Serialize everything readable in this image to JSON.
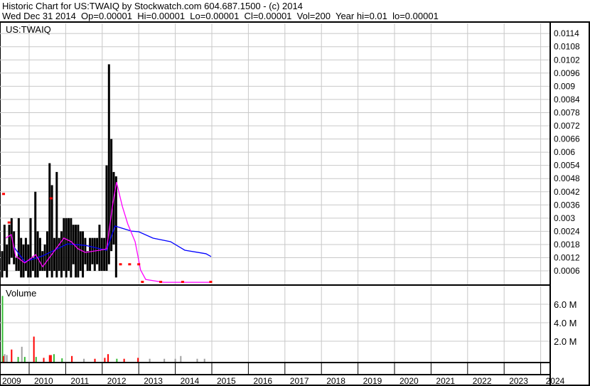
{
  "header": {
    "line1": "Historic Chart for US:TWAIQ by Stockwatch.com 604.687.1500 - (c) 2014",
    "line2": "Wed Dec 31 2014  Op=0.00001  Hi=0.00001  Lo=0.00001  Cl=0.00001  Vol=200  Year hi=0.01  lo=0.00001"
  },
  "colors": {
    "bars": "#000000",
    "ma_short": "#ff00ff",
    "ma_long": "#0000ff",
    "marker": "#ff0000",
    "grid": "#c8c8c8",
    "vol_up": "#33bb33",
    "vol_down": "#ff0000",
    "vol_flat": "#a0a0a0"
  },
  "chart_data": [
    {
      "type": "line",
      "title": "US:TWAIQ",
      "ylim": [
        0,
        0.0117
      ],
      "y_ticks": [
        "0.0114",
        "0.0108",
        "0.0102",
        "0.0096",
        "0.009",
        "0.0084",
        "0.0078",
        "0.0072",
        "0.0066",
        "0.006",
        "0.0054",
        "0.0048",
        "0.0042",
        "0.0036",
        "0.003",
        "0.0024",
        "0.0018",
        "0.0012",
        "0.0006"
      ],
      "y_tick_values": [
        0.0114,
        0.0108,
        0.0102,
        0.0096,
        0.009,
        0.0084,
        0.0078,
        0.0072,
        0.0066,
        0.006,
        0.0054,
        0.0048,
        0.0042,
        0.0036,
        0.003,
        0.0024,
        0.0018,
        0.0012,
        0.0006
      ],
      "x_range_years": [
        2009.2,
        2024.3
      ],
      "bars_start_year": 2009.26,
      "bars_step_years": 0.065,
      "bars_low_high": [
        [
          0.0003,
          0.0015
        ],
        [
          0.0006,
          0.0027
        ],
        [
          0.0003,
          0.0018
        ],
        [
          0.0009,
          0.0027
        ],
        [
          0.0012,
          0.003
        ],
        [
          0.0009,
          0.0024
        ],
        [
          0.0006,
          0.0012
        ],
        [
          0.0006,
          0.003
        ],
        [
          0.0003,
          0.0021
        ],
        [
          0.0003,
          0.0018
        ],
        [
          0.0006,
          0.0021
        ],
        [
          0.0003,
          0.0018
        ],
        [
          0.0003,
          0.003
        ],
        [
          0.0006,
          0.0012
        ],
        [
          0.0003,
          0.0042
        ],
        [
          0.0003,
          0.0024
        ],
        [
          0.0006,
          0.0021
        ],
        [
          0.0006,
          0.0015
        ],
        [
          0.0006,
          0.0018
        ],
        [
          0.0003,
          0.0024
        ],
        [
          0.0006,
          0.0055
        ],
        [
          0.0003,
          0.0045
        ],
        [
          0.0006,
          0.0021
        ],
        [
          0.0003,
          0.0051
        ],
        [
          0.0006,
          0.0021
        ],
        [
          0.0003,
          0.0024
        ],
        [
          0.0006,
          0.003
        ],
        [
          0.0003,
          0.003
        ],
        [
          0.0006,
          0.003
        ],
        [
          0.0003,
          0.003
        ],
        [
          0.0009,
          0.0027
        ],
        [
          0.0003,
          0.0027
        ],
        [
          0.0003,
          0.0027
        ],
        [
          0.0006,
          0.0024
        ],
        [
          0.0003,
          0.0024
        ],
        [
          0.0009,
          0.0021
        ],
        [
          0.0006,
          0.0015
        ],
        [
          0.0006,
          0.0021
        ],
        [
          0.0009,
          0.0021
        ],
        [
          0.0006,
          0.0021
        ],
        [
          0.0009,
          0.0021
        ],
        [
          0.0006,
          0.0027
        ],
        [
          0.0006,
          0.0021
        ],
        [
          0.0006,
          0.0021
        ],
        [
          0.0006,
          0.0054
        ],
        [
          0.0009,
          0.01
        ],
        [
          0.0015,
          0.0066
        ],
        [
          0.0018,
          0.0051
        ],
        [
          0.0003,
          0.0049
        ]
      ],
      "series": [
        {
          "name": "long moving average",
          "color_key": "ma_long",
          "points": [
            [
              2009.59,
              0.00167
            ],
            [
              2009.88,
              0.00102
            ],
            [
              2010.37,
              0.00128
            ],
            [
              2011.05,
              0.00183
            ],
            [
              2011.54,
              0.00176
            ],
            [
              2012.12,
              0.00154
            ],
            [
              2012.35,
              0.00264
            ],
            [
              2012.8,
              0.00241
            ],
            [
              2013.0,
              0.00238
            ],
            [
              2013.39,
              0.00209
            ],
            [
              2013.87,
              0.00193
            ],
            [
              2014.26,
              0.00154
            ],
            [
              2014.84,
              0.00138
            ],
            [
              2014.98,
              0.00125
            ]
          ]
        },
        {
          "name": "short moving average",
          "color_key": "ma_short",
          "points": [
            [
              2009.36,
              0.00209
            ],
            [
              2009.51,
              0.00225
            ],
            [
              2009.63,
              0.00128
            ],
            [
              2009.88,
              0.00096
            ],
            [
              2010.18,
              0.00134
            ],
            [
              2010.37,
              0.00079
            ],
            [
              2010.66,
              0.00144
            ],
            [
              2010.95,
              0.00209
            ],
            [
              2011.15,
              0.00193
            ],
            [
              2011.34,
              0.0016
            ],
            [
              2011.54,
              0.00144
            ],
            [
              2011.93,
              0.00154
            ],
            [
              2012.12,
              0.0016
            ],
            [
              2012.28,
              0.00354
            ],
            [
              2012.39,
              0.00464
            ],
            [
              2012.55,
              0.00354
            ],
            [
              2012.7,
              0.00273
            ],
            [
              2012.9,
              0.00193
            ],
            [
              2013.05,
              0.00064
            ],
            [
              2013.19,
              0.00021
            ],
            [
              2013.68,
              8e-05
            ],
            [
              2014.98,
              8e-05
            ]
          ]
        },
        {
          "name": "close markers",
          "color_key": "marker",
          "points": [
            [
              2009.3,
              0.0041
            ],
            [
              2009.45,
              0.0028
            ],
            [
              2010.6,
              0.0039
            ],
            [
              2012.5,
              0.0009
            ],
            [
              2012.75,
              0.0009
            ],
            [
              2013.0,
              0.0009
            ],
            [
              2013.1,
              0.0001
            ],
            [
              2013.6,
              0.0001
            ],
            [
              2014.2,
              0.0001
            ],
            [
              2014.97,
              0.0001
            ]
          ]
        }
      ]
    },
    {
      "type": "bar",
      "title": "Volume",
      "ylim": [
        0,
        8
      ],
      "y_unit": "M",
      "y_ticks": [
        "6.0 M",
        "4.0 M",
        "2.0 M"
      ],
      "y_tick_values": [
        6,
        4,
        2
      ],
      "bars_year_vol_dir": [
        [
          2009.27,
          6.9,
          "up"
        ],
        [
          2009.3,
          0.4,
          "down"
        ],
        [
          2009.33,
          0.6,
          "flat"
        ],
        [
          2009.39,
          0.5,
          "flat"
        ],
        [
          2009.52,
          1.1,
          "down"
        ],
        [
          2009.7,
          0.3,
          "up"
        ],
        [
          2009.8,
          1.4,
          "flat"
        ],
        [
          2009.88,
          0.3,
          "up"
        ],
        [
          2010.13,
          2.5,
          "down"
        ],
        [
          2010.19,
          0.3,
          "up"
        ],
        [
          2010.4,
          0.2,
          "down"
        ],
        [
          2010.56,
          0.5,
          "down"
        ],
        [
          2010.6,
          0.5,
          "down"
        ],
        [
          2010.68,
          0.6,
          "up"
        ],
        [
          2010.9,
          0.15,
          "up"
        ],
        [
          2011.17,
          0.4,
          "down"
        ],
        [
          2011.5,
          0.1,
          "flat"
        ],
        [
          2011.8,
          0.1,
          "down"
        ],
        [
          2012.07,
          0.2,
          "down"
        ],
        [
          2012.16,
          0.6,
          "down"
        ],
        [
          2012.4,
          0.1,
          "up"
        ],
        [
          2012.6,
          0.1,
          "down"
        ],
        [
          2012.98,
          0.2,
          "down"
        ],
        [
          2013.3,
          0.1,
          "flat"
        ],
        [
          2013.7,
          0.1,
          "flat"
        ],
        [
          2014.0,
          0.1,
          "flat"
        ],
        [
          2014.15,
          0.4,
          "flat"
        ],
        [
          2014.6,
          0.1,
          "flat"
        ],
        [
          2014.8,
          0.1,
          "flat"
        ]
      ]
    }
  ],
  "x_axis": {
    "labels": [
      "2009",
      "2010",
      "2011",
      "2012",
      "2013",
      "2014",
      "2015",
      "2016",
      "2017",
      "2018",
      "2019",
      "2020",
      "2021",
      "2022",
      "2023",
      "2024"
    ]
  }
}
